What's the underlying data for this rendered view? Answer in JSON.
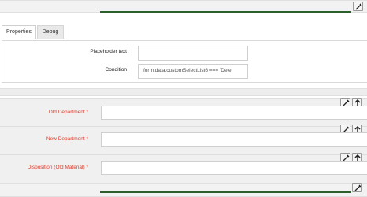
{
  "tabs": [
    {
      "label": "Properties"
    },
    {
      "label": "Debug"
    }
  ],
  "properties": {
    "placeholder_label": "Placeholder text",
    "placeholder_value": "",
    "condition_label": "Condition",
    "condition_value": "form.data.customSelectList6 === 'Dele"
  },
  "fields": [
    {
      "label": "Old Department *",
      "value": ""
    },
    {
      "label": "New Department *",
      "value": ""
    },
    {
      "label": "Disposition (Old Material) *",
      "value": ""
    }
  ],
  "icons": {
    "wrench": "wrench-icon",
    "up": "arrow-up-icon"
  },
  "colors": {
    "required_label": "#e03c2c",
    "accent_line": "#2b5f2b"
  }
}
